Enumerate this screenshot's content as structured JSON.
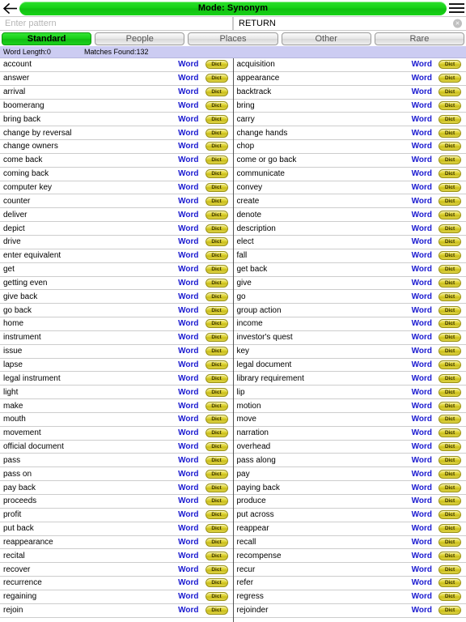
{
  "topbar": {
    "back_icon": "back-arrow-icon",
    "title": "Mode: Synonym",
    "menu_icon": "hamburger-menu-icon"
  },
  "search": {
    "pattern_placeholder": "Enter pattern",
    "pattern_value": "",
    "return_value": "RETURN",
    "clear_label": "×"
  },
  "tabs": [
    {
      "label": "Standard",
      "active": true
    },
    {
      "label": "People",
      "active": false
    },
    {
      "label": "Places",
      "active": false
    },
    {
      "label": "Other",
      "active": false
    },
    {
      "label": "Rare",
      "active": false
    }
  ],
  "info": {
    "word_length": "Word Length:0",
    "matches_found": "Matches Found:132"
  },
  "row_actions": {
    "word_label": "Word",
    "dict_label": "Dict"
  },
  "colors": {
    "accent_green": "#16cf16",
    "link_blue": "#1a1ad0",
    "info_bar": "#ccccf2",
    "dict_yellow": "#ded335"
  },
  "results": {
    "left_column": [
      "account",
      "answer",
      "arrival",
      "boomerang",
      "bring back",
      "change by reversal",
      "change owners",
      "come back",
      "coming back",
      "computer key",
      "counter",
      "deliver",
      "depict",
      "drive",
      "enter equivalent",
      "get",
      "getting even",
      "give back",
      "go back",
      "home",
      "instrument",
      "issue",
      "lapse",
      "legal instrument",
      "light",
      "make",
      "mouth",
      "movement",
      "official document",
      "pass",
      "pass on",
      "pay back",
      "proceeds",
      "profit",
      "put back",
      "reappearance",
      "recital",
      "recover",
      "recurrence",
      "regaining",
      "rejoin"
    ],
    "right_column": [
      "acquisition",
      "appearance",
      "backtrack",
      "bring",
      "carry",
      "change hands",
      "chop",
      "come or go back",
      "communicate",
      "convey",
      "create",
      "denote",
      "description",
      "elect",
      "fall",
      "get back",
      "give",
      "go",
      "group action",
      "income",
      "investor's quest",
      "key",
      "legal document",
      "library requirement",
      "lip",
      "motion",
      "move",
      "narration",
      "overhead",
      "pass along",
      "pay",
      "paying back",
      "produce",
      "put across",
      "reappear",
      "recall",
      "recompense",
      "recur",
      "refer",
      "regress",
      "rejoinder"
    ]
  }
}
